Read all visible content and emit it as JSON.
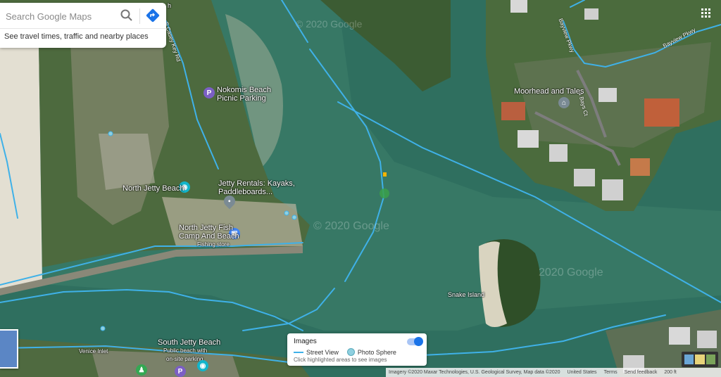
{
  "search": {
    "placeholder": "Search Google Maps",
    "subtitle": "See travel times, traffic and nearby places"
  },
  "places": [
    {
      "name": "Nokomis Beach Picnic Parking",
      "line1": "Nokomis Beach",
      "line2": "Picnic Parking"
    },
    {
      "name": "North Jetty Beach",
      "line1": "North Jetty Beach"
    },
    {
      "name": "Jetty Rentals: Kayaks, Paddleboards...",
      "line1": "Jetty Rentals: Kayaks,",
      "line2": "Paddleboards..."
    },
    {
      "name": "North Jetty Fish Camp And Beach",
      "line1": "North Jetty Fish",
      "line2": "Camp And Beach",
      "line3": "Fishing store"
    },
    {
      "name": "Moorhead and Tales",
      "line1": "Moorhead and Tales"
    },
    {
      "name": "Snake Island",
      "line1": "Snake Island"
    },
    {
      "name": "South Jetty Beach",
      "line1": "South Jetty Beach",
      "line2": "Public beach with",
      "line3": "on-site parking"
    },
    {
      "name": "Venice Inlet",
      "line1": "Venice Inlet"
    }
  ],
  "roads": {
    "casey_key": "S Casey Key Rd",
    "bayview_pkwy_1": "Bayview Pkwy",
    "bayview_pkwy_2": "Bayview Pkwy",
    "bays_ct": "4 Bays Ct"
  },
  "top_label": "h",
  "watermarks": [
    "© 2020 Google",
    "© 2020 Google",
    "2020 Google"
  ],
  "legend": {
    "title": "Images",
    "street_view": "Street View",
    "photo_sphere": "Photo Sphere",
    "hint": "Click highlighted areas to see images"
  },
  "footer": {
    "attribution": "Imagery ©2020 Maxar Technologies, U.S. Geological Survey, Map data ©2020",
    "country": "United States",
    "terms": "Terms",
    "feedback": "Send feedback",
    "scale": "200 ft"
  },
  "colors": {
    "water": "#2f6f5f",
    "street_view_line": "#3fb1e8",
    "accent": "#1a73e8",
    "poi_pin": "#7b5fc4"
  }
}
